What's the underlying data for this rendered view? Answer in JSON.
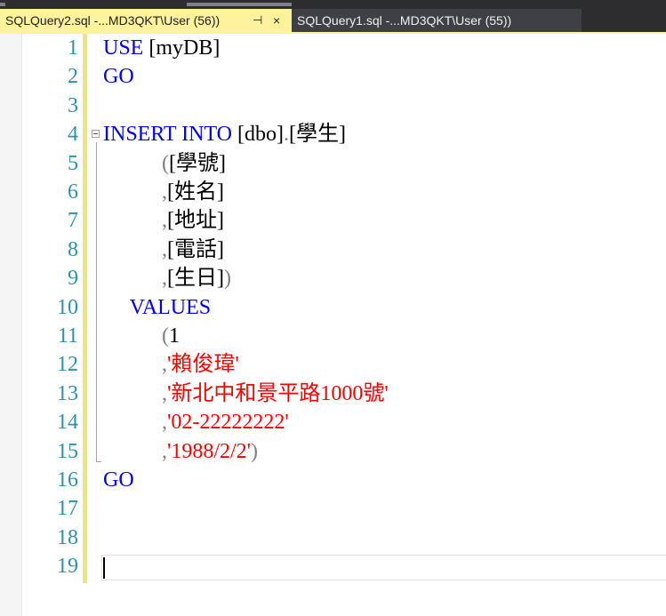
{
  "tabs": [
    {
      "label": "SQLQuery2.sql -...MD3QKT\\User (56))",
      "active": true,
      "pin_icon": "pin-icon",
      "close_icon": "close-icon"
    },
    {
      "label": "SQLQuery1.sql -...MD3QKT\\User (55))",
      "active": false
    }
  ],
  "editor": {
    "line_numbers": [
      "1",
      "2",
      "3",
      "4",
      "5",
      "6",
      "7",
      "8",
      "9",
      "10",
      "11",
      "12",
      "13",
      "14",
      "15",
      "16",
      "17",
      "18",
      "19"
    ],
    "lines": [
      {
        "tokens": [
          {
            "t": "kw",
            "v": "USE"
          },
          {
            "t": "id",
            "v": " [myDB]"
          }
        ]
      },
      {
        "tokens": [
          {
            "t": "kw",
            "v": "GO"
          }
        ]
      },
      {
        "tokens": []
      },
      {
        "tokens": [
          {
            "t": "kw",
            "v": "INSERT"
          },
          {
            "t": "id",
            "v": " "
          },
          {
            "t": "kw",
            "v": "INTO"
          },
          {
            "t": "id",
            "v": " [dbo]"
          },
          {
            "t": "op",
            "v": "."
          },
          {
            "t": "id",
            "v": "[學生]"
          }
        ]
      },
      {
        "tokens": [
          {
            "t": "id",
            "v": "           "
          },
          {
            "t": "op",
            "v": "("
          },
          {
            "t": "id",
            "v": "[學號]"
          }
        ]
      },
      {
        "tokens": [
          {
            "t": "id",
            "v": "           "
          },
          {
            "t": "op",
            "v": ","
          },
          {
            "t": "id",
            "v": "[姓名]"
          }
        ]
      },
      {
        "tokens": [
          {
            "t": "id",
            "v": "           "
          },
          {
            "t": "op",
            "v": ","
          },
          {
            "t": "id",
            "v": "[地址]"
          }
        ]
      },
      {
        "tokens": [
          {
            "t": "id",
            "v": "           "
          },
          {
            "t": "op",
            "v": ","
          },
          {
            "t": "id",
            "v": "[電話]"
          }
        ]
      },
      {
        "tokens": [
          {
            "t": "id",
            "v": "           "
          },
          {
            "t": "op",
            "v": ","
          },
          {
            "t": "id",
            "v": "[生日]"
          },
          {
            "t": "op",
            "v": ")"
          }
        ]
      },
      {
        "tokens": [
          {
            "t": "id",
            "v": "     "
          },
          {
            "t": "kw",
            "v": "VALUES"
          }
        ]
      },
      {
        "tokens": [
          {
            "t": "id",
            "v": "           "
          },
          {
            "t": "op",
            "v": "("
          },
          {
            "t": "num",
            "v": "1"
          }
        ]
      },
      {
        "tokens": [
          {
            "t": "id",
            "v": "           "
          },
          {
            "t": "op",
            "v": ","
          },
          {
            "t": "str",
            "v": "'賴俊瑋'"
          }
        ]
      },
      {
        "tokens": [
          {
            "t": "id",
            "v": "           "
          },
          {
            "t": "op",
            "v": ","
          },
          {
            "t": "str",
            "v": "'新北中和景平路1000號'"
          }
        ]
      },
      {
        "tokens": [
          {
            "t": "id",
            "v": "           "
          },
          {
            "t": "op",
            "v": ","
          },
          {
            "t": "str",
            "v": "'02-22222222'"
          }
        ]
      },
      {
        "tokens": [
          {
            "t": "id",
            "v": "           "
          },
          {
            "t": "op",
            "v": ","
          },
          {
            "t": "str",
            "v": "'1988/2/2'"
          },
          {
            "t": "op",
            "v": ")"
          }
        ]
      },
      {
        "tokens": [
          {
            "t": "kw",
            "v": "GO"
          }
        ]
      },
      {
        "tokens": []
      },
      {
        "tokens": []
      },
      {
        "tokens": []
      }
    ]
  },
  "colors": {
    "keyword": "#0000ff",
    "string": "#ff0000",
    "operator": "#808080",
    "line_number": "#2b91af",
    "active_tab": "#fff29d"
  }
}
